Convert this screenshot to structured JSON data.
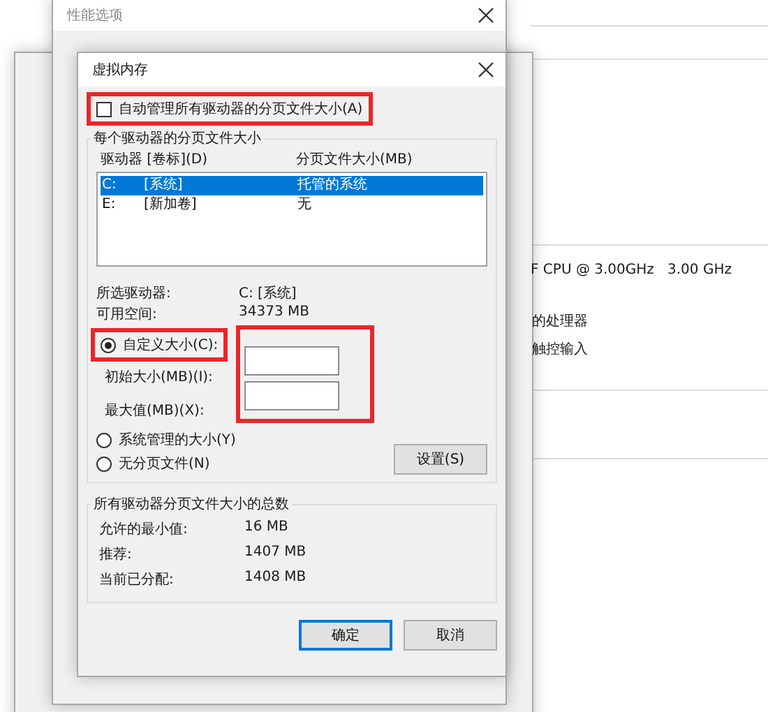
{
  "system_window": {
    "cpu": "F CPU @ 3.00GHz",
    "speed": "3.00 GHz",
    "processor_note": "的处理器",
    "touch_note": "触控输入"
  },
  "performance_window": {
    "title": "性能选项"
  },
  "dialog": {
    "title": "虚拟内存",
    "auto_manage": {
      "label": "自动管理所有驱动器的分页文件大小(A)",
      "checked": false
    },
    "drives_group": {
      "title": "每个驱动器的分页文件大小",
      "columns": [
        "驱动器 [卷标](D)",
        "分页文件大小(MB)"
      ],
      "drives": [
        {
          "letter": "C:",
          "label": "[系统]",
          "size": "托管的系统",
          "selected": true
        },
        {
          "letter": "E:",
          "label": "[新加卷]",
          "size": "无",
          "selected": false
        }
      ],
      "selected_drive": {
        "label": "所选驱动器:",
        "value": "C: [系统]"
      },
      "free_space": {
        "label": "可用空间:",
        "value": "34373 MB"
      },
      "options": [
        {
          "kind": "custom",
          "label": "自定义大小(C):",
          "selected": true
        },
        {
          "kind": "plain",
          "label": "系统管理的大小(Y)",
          "selected": false
        },
        {
          "kind": "plain",
          "label": "无分页文件(N)",
          "selected": false
        }
      ],
      "initial_size": {
        "label": "初始大小(MB)(I):"
      },
      "max_size": {
        "label": "最大值(MB)(X):"
      },
      "set_button": "设置(S)"
    },
    "totals_group": {
      "title": "所有驱动器分页文件大小的总数",
      "rows": [
        {
          "label": "允许的最小值:",
          "value": "16 MB"
        },
        {
          "label": "推荐:",
          "value": "1407 MB"
        },
        {
          "label": "当前已分配:",
          "value": "1408 MB"
        }
      ]
    },
    "buttons": [
      {
        "label": "确定",
        "focused": true
      },
      {
        "label": "取消",
        "focused": false
      }
    ]
  }
}
